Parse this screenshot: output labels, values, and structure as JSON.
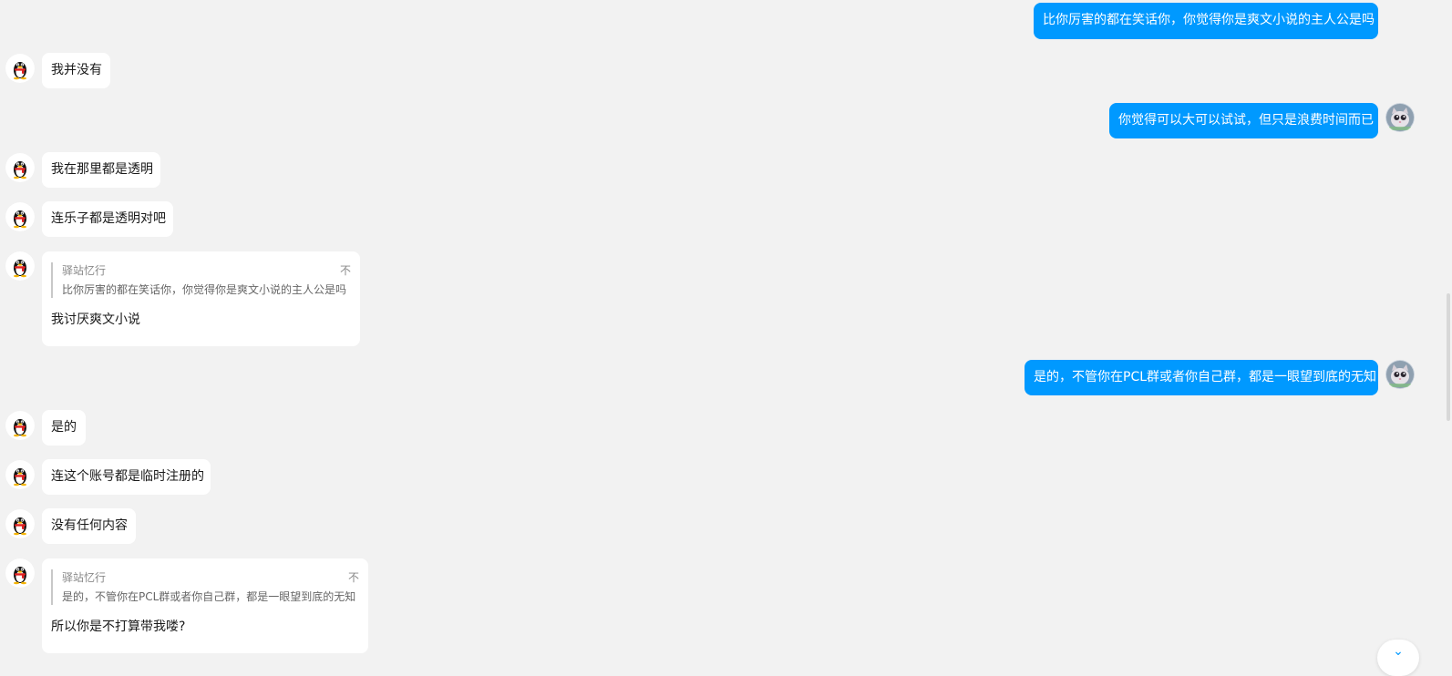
{
  "colors": {
    "background": "#f2f2f2",
    "outgoing": "#0099ff",
    "incoming": "#ffffff",
    "quote_bar": "#c8c8c8"
  },
  "icons": {
    "incoming_avatar": "qq-penguin-icon",
    "outgoing_avatar": "cat-avatar-icon",
    "jump": "chevron-down-icon"
  },
  "messages": [
    {
      "from": "me",
      "text": "比你厉害的都在笑话你，你觉得你是爽文小说的主人公是吗"
    },
    {
      "from": "other",
      "text": "我并没有"
    },
    {
      "from": "me",
      "text": "你觉得可以大可以试试，但只是浪费时间而已"
    },
    {
      "from": "other",
      "text": "我在那里都是透明"
    },
    {
      "from": "other",
      "text": "连乐子都是透明对吧"
    },
    {
      "from": "other",
      "quote": {
        "name": "驿站忆行",
        "text": "比你厉害的都在笑话你，你觉得你是爽文小说的主人公是吗",
        "mark": "不"
      },
      "text": "我讨厌爽文小说"
    },
    {
      "from": "me",
      "text": "是的，不管你在PCL群或者你自己群，都是一眼望到底的无知"
    },
    {
      "from": "other",
      "text": "是的"
    },
    {
      "from": "other",
      "text": "连这个账号都是临时注册的"
    },
    {
      "from": "other",
      "text": "没有任何内容"
    },
    {
      "from": "other",
      "quote": {
        "name": "驿站忆行",
        "text": "是的，不管你在PCL群或者你自己群，都是一眼望到底的无知",
        "mark": "不"
      },
      "text": "所以你是不打算带我喽?"
    }
  ],
  "jump_button": "⌄"
}
